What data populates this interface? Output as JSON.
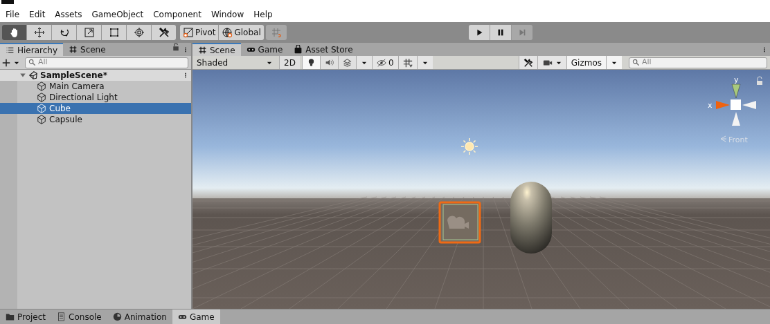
{
  "menu": [
    "File",
    "Edit",
    "Assets",
    "GameObject",
    "Component",
    "Window",
    "Help"
  ],
  "tools": [
    {
      "kind": "hand",
      "selected": true
    },
    {
      "kind": "move",
      "selected": false
    },
    {
      "kind": "rotate",
      "selected": false
    },
    {
      "kind": "scale",
      "selected": false
    },
    {
      "kind": "rect",
      "selected": false
    },
    {
      "kind": "transform",
      "selected": false
    },
    {
      "kind": "custom",
      "selected": false
    }
  ],
  "handle_toggles": [
    {
      "kind": "pivot",
      "label": "Pivot"
    },
    {
      "kind": "global",
      "label": "Global"
    }
  ],
  "grid_snap": {
    "on": false
  },
  "playback": [
    {
      "kind": "play",
      "disabled": false
    },
    {
      "kind": "pause",
      "disabled": false
    },
    {
      "kind": "step",
      "disabled": true
    }
  ],
  "hierarchy": {
    "tabs": [
      {
        "kind": "list",
        "label": "Hierarchy",
        "selected": true
      },
      {
        "kind": "grid",
        "label": "Scene",
        "selected": false
      }
    ],
    "search": {
      "placeholder": "All"
    },
    "scene": {
      "name": "SampleScene*",
      "expanded": true,
      "children": [
        {
          "name": "Main Camera",
          "selected": false
        },
        {
          "name": "Directional Light",
          "selected": false
        },
        {
          "name": "Cube",
          "selected": true
        },
        {
          "name": "Capsule",
          "selected": false
        }
      ]
    }
  },
  "scene_view": {
    "tabs": [
      {
        "kind": "grid",
        "label": "Scene",
        "selected": true
      },
      {
        "kind": "gamepad",
        "label": "Game",
        "selected": false
      },
      {
        "kind": "bag",
        "label": "Asset Store",
        "selected": false
      }
    ],
    "draw_mode": "Shaded",
    "mode_2d": {
      "label": "2D",
      "on": false
    },
    "toggles": [
      {
        "kind": "lighting",
        "on": true
      },
      {
        "kind": "audio",
        "on": false
      },
      {
        "kind": "effects",
        "on": false
      }
    ],
    "hidden_count": "0",
    "gizmos": "Gizmos",
    "search": {
      "placeholder": "All"
    },
    "orientation": {
      "y_label": "y",
      "x_label": "x",
      "view": "Front"
    }
  },
  "bottom_tabs": [
    {
      "kind": "folder",
      "label": "Project",
      "selected": false
    },
    {
      "kind": "console",
      "label": "Console",
      "selected": false
    },
    {
      "kind": "clock",
      "label": "Animation",
      "selected": false
    },
    {
      "kind": "gamepad",
      "label": "Game",
      "selected": true
    }
  ]
}
